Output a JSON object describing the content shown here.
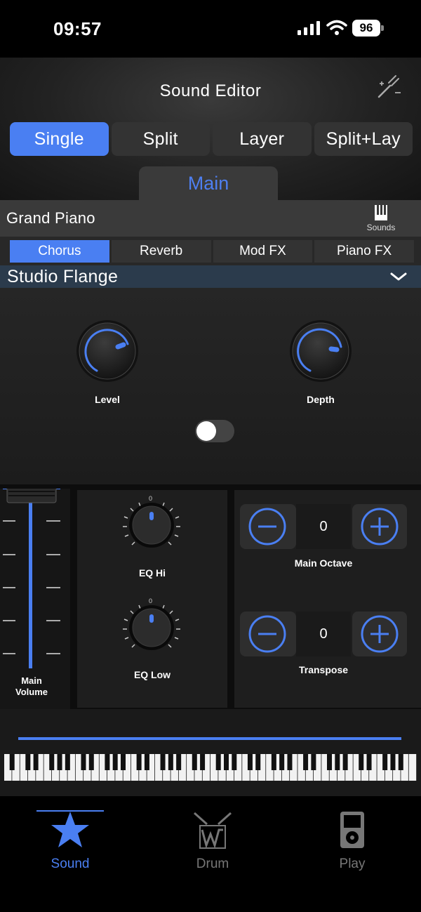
{
  "status": {
    "time": "09:57",
    "battery": "96"
  },
  "header": {
    "title": "Sound Editor",
    "modes": [
      "Single",
      "Split",
      "Layer",
      "Split+Lay"
    ],
    "active_mode": "Single",
    "tab": "Main"
  },
  "instrument": {
    "name": "Grand Piano",
    "sounds_label": "Sounds"
  },
  "fx": {
    "tabs": [
      "Chorus",
      "Reverb",
      "Mod FX",
      "Piano FX"
    ],
    "active_tab": "Chorus",
    "preset": "Studio Flange",
    "level_label": "Level",
    "depth_label": "Depth",
    "enabled": false
  },
  "mixer": {
    "volume_label_line1": "Main",
    "volume_label_line2": "Volume",
    "eq_hi_label": "EQ Hi",
    "eq_low_label": "EQ Low",
    "eq_scale_zero": "0",
    "octave_value": "0",
    "octave_label": "Main Octave",
    "transpose_value": "0",
    "transpose_label": "Transpose"
  },
  "tabbar": {
    "items": [
      {
        "label": "Sound",
        "icon": "star-icon",
        "active": true
      },
      {
        "label": "Drum",
        "icon": "drum-icon",
        "active": false
      },
      {
        "label": "Play",
        "icon": "player-icon",
        "active": false
      }
    ]
  },
  "colors": {
    "accent": "#4a7ff2",
    "background": "#000000",
    "panel": "#1e1e1e"
  }
}
